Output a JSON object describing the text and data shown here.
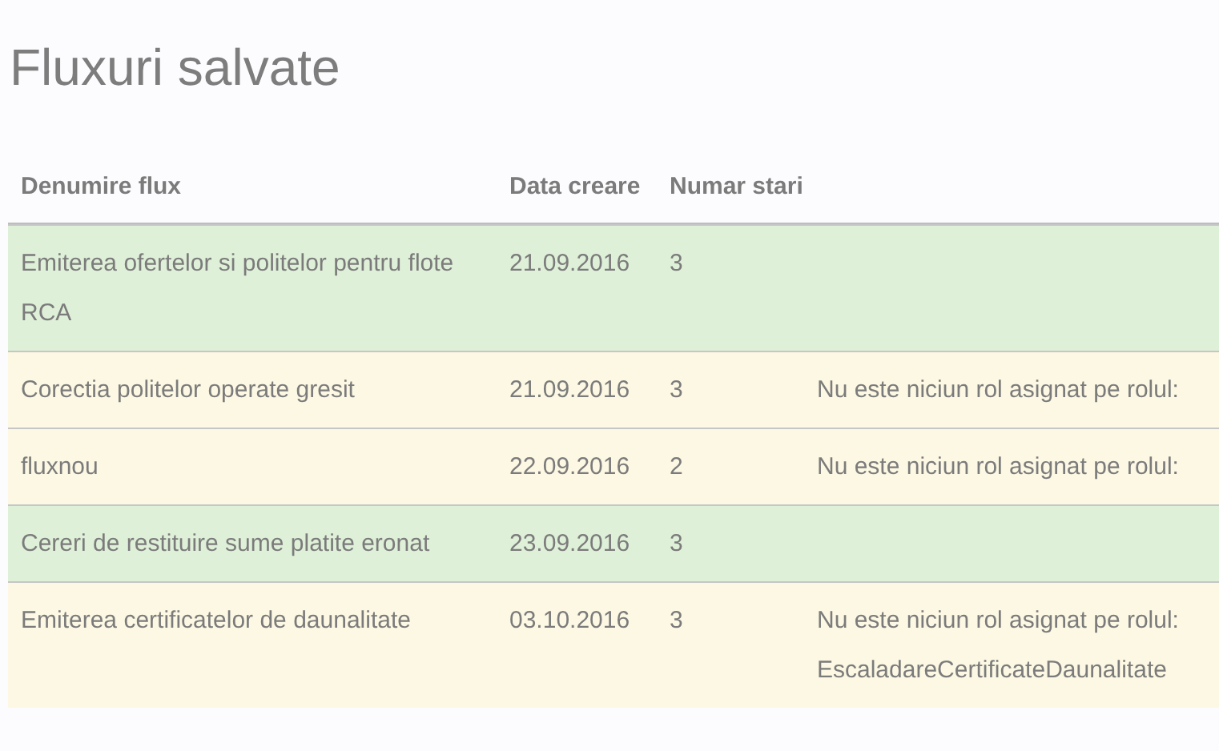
{
  "title": "Fluxuri salvate",
  "table": {
    "columns": [
      {
        "label": "Denumire flux"
      },
      {
        "label": "Data creare"
      },
      {
        "label": "Numar stari"
      },
      {}
    ],
    "rows": [
      {
        "kind": "success",
        "name": "Emiterea ofertelor si politelor pentru flote RCA",
        "date": "21.09.2016",
        "states": "3"
      },
      {
        "kind": "warning",
        "name": "Corectia politelor operate gresit",
        "date": "21.09.2016",
        "states": "3",
        "message": "Nu este niciun rol asignat pe rolul:"
      },
      {
        "kind": "warning",
        "name": "fluxnou",
        "date": "22.09.2016",
        "states": "2",
        "message": "Nu este niciun rol asignat pe rolul:"
      },
      {
        "kind": "success",
        "name": "Cereri de restituire sume platite eronat",
        "date": "23.09.2016",
        "states": "3"
      },
      {
        "kind": "warning",
        "name": "Emiterea certificatelor de daunalitate",
        "date": "03.10.2016",
        "states": "3",
        "message": "Nu este niciun rol asignat pe rolul: EscaladareCertificateDaunalitate"
      }
    ]
  }
}
